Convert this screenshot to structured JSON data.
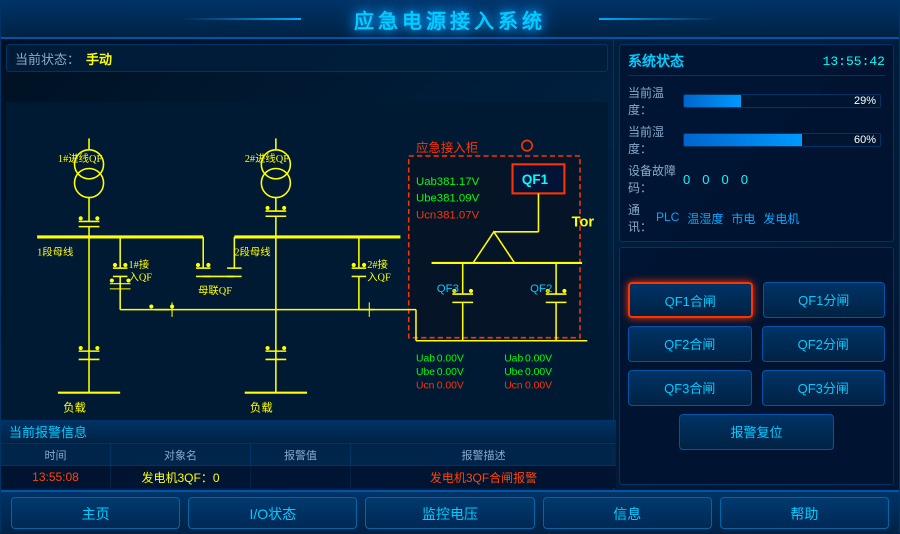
{
  "title": "应急电源接入系统",
  "status": {
    "label": "当前状态：",
    "value": "手动"
  },
  "time": "13:55:42",
  "system_status": {
    "title": "系统状态",
    "temperature": {
      "label": "当前温度：",
      "value": "29%",
      "percent": 29
    },
    "humidity": {
      "label": "当前湿度：",
      "value": "60%",
      "percent": 60
    },
    "fault": {
      "label": "设备故障码：",
      "values": [
        "0",
        "0",
        "0",
        "0"
      ]
    },
    "comm": {
      "label": "通  讯：",
      "items": [
        "PLC",
        "温湿度",
        "市电",
        "发电机"
      ]
    }
  },
  "controls": {
    "qf1_close": "QF1合闸",
    "qf1_open": "QF1分闸",
    "qf2_close": "QF2合闸",
    "qf2_open": "QF2分闸",
    "qf3_close": "QF3合闸",
    "qf3_open": "QF3分闸",
    "alarm_reset": "报警复位"
  },
  "alarm": {
    "section_title": "当前报警信息",
    "headers": [
      "时间",
      "对象名",
      "报警值",
      "报警描述"
    ],
    "row": {
      "time": "13:55:08",
      "object": "发电机3QF：0",
      "value": "",
      "desc": "发电机3QF合闸报警"
    }
  },
  "nav": {
    "items": [
      "主页",
      "I/O状态",
      "监控电压",
      "信息",
      "帮助"
    ]
  },
  "schematic": {
    "emergency_label": "应急接入柜",
    "voltages": {
      "uab1": "381.17V",
      "ubc1": "381.09V",
      "ucn1": "381.07V",
      "uab2": "0.00V",
      "ubc2": "0.00V",
      "ucn2": "0.00V",
      "uab3": "0.00V",
      "ubc3": "0.00V",
      "ucn3": "0.00V"
    },
    "labels": {
      "feeder1": "1#进线QF",
      "feeder2": "2#进线QF",
      "bus1": "1段母线",
      "bus2": "2段母线",
      "load1": "负载",
      "load2": "负载",
      "link1": "1#接入QF",
      "link2": "2#接入QF",
      "bus_tie": "母联QF",
      "qf1": "QF1",
      "qf2": "QF2",
      "qf3": "QF3",
      "tor": "Tor"
    }
  }
}
